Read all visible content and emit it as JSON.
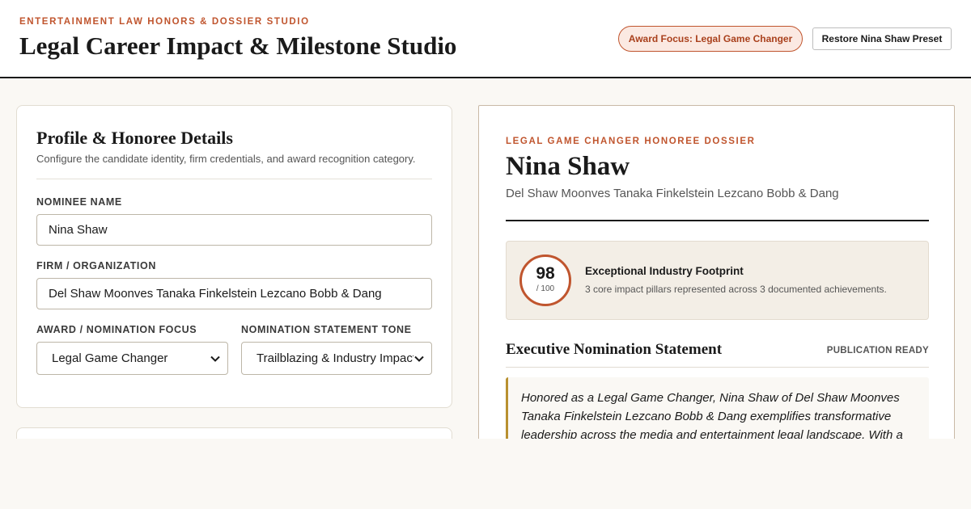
{
  "header": {
    "eyebrow": "ENTERTAINMENT LAW HONORS & DOSSIER STUDIO",
    "title": "Legal Career Impact & Milestone Studio",
    "award_focus_button": "Award Focus: Legal Game Changer",
    "restore_button": "Restore Nina Shaw Preset"
  },
  "profile_form": {
    "title": "Profile & Honoree Details",
    "subtitle": "Configure the candidate identity, firm credentials, and award recognition category.",
    "nominee_label": "NOMINEE NAME",
    "nominee_value": "Nina Shaw",
    "firm_label": "FIRM / ORGANIZATION",
    "firm_value": "Del Shaw Moonves Tanaka Finkelstein Lezcano Bobb & Dang",
    "award_label": "AWARD / NOMINATION FOCUS",
    "award_value": "Legal Game Changer",
    "tone_label": "NOMINATION STATEMENT TONE",
    "tone_value": "Trailblazing & Industry Impact"
  },
  "dossier": {
    "eyebrow": "LEGAL GAME CHANGER HONOREE DOSSIER",
    "name": "Nina Shaw",
    "firm": "Del Shaw Moonves Tanaka Finkelstein Lezcano Bobb & Dang",
    "score": {
      "value": "98",
      "max": "/ 100",
      "title": "Exceptional Industry Footprint",
      "description": "3 core impact pillars represented across 3 documented achievements."
    },
    "statement": {
      "title": "Executive Nomination Statement",
      "status": "PUBLICATION READY",
      "text": "Honored as a Legal Game Changer, Nina Shaw of Del Shaw Moonves Tanaka Finkelstein Lezcano Bobb & Dang exemplifies transformative leadership across the media and entertainment legal landscape. With a"
    }
  },
  "colors": {
    "accent": "#c0552e",
    "gold": "#b8902f",
    "ink": "#1a1a1a",
    "background": "#faf8f4"
  }
}
